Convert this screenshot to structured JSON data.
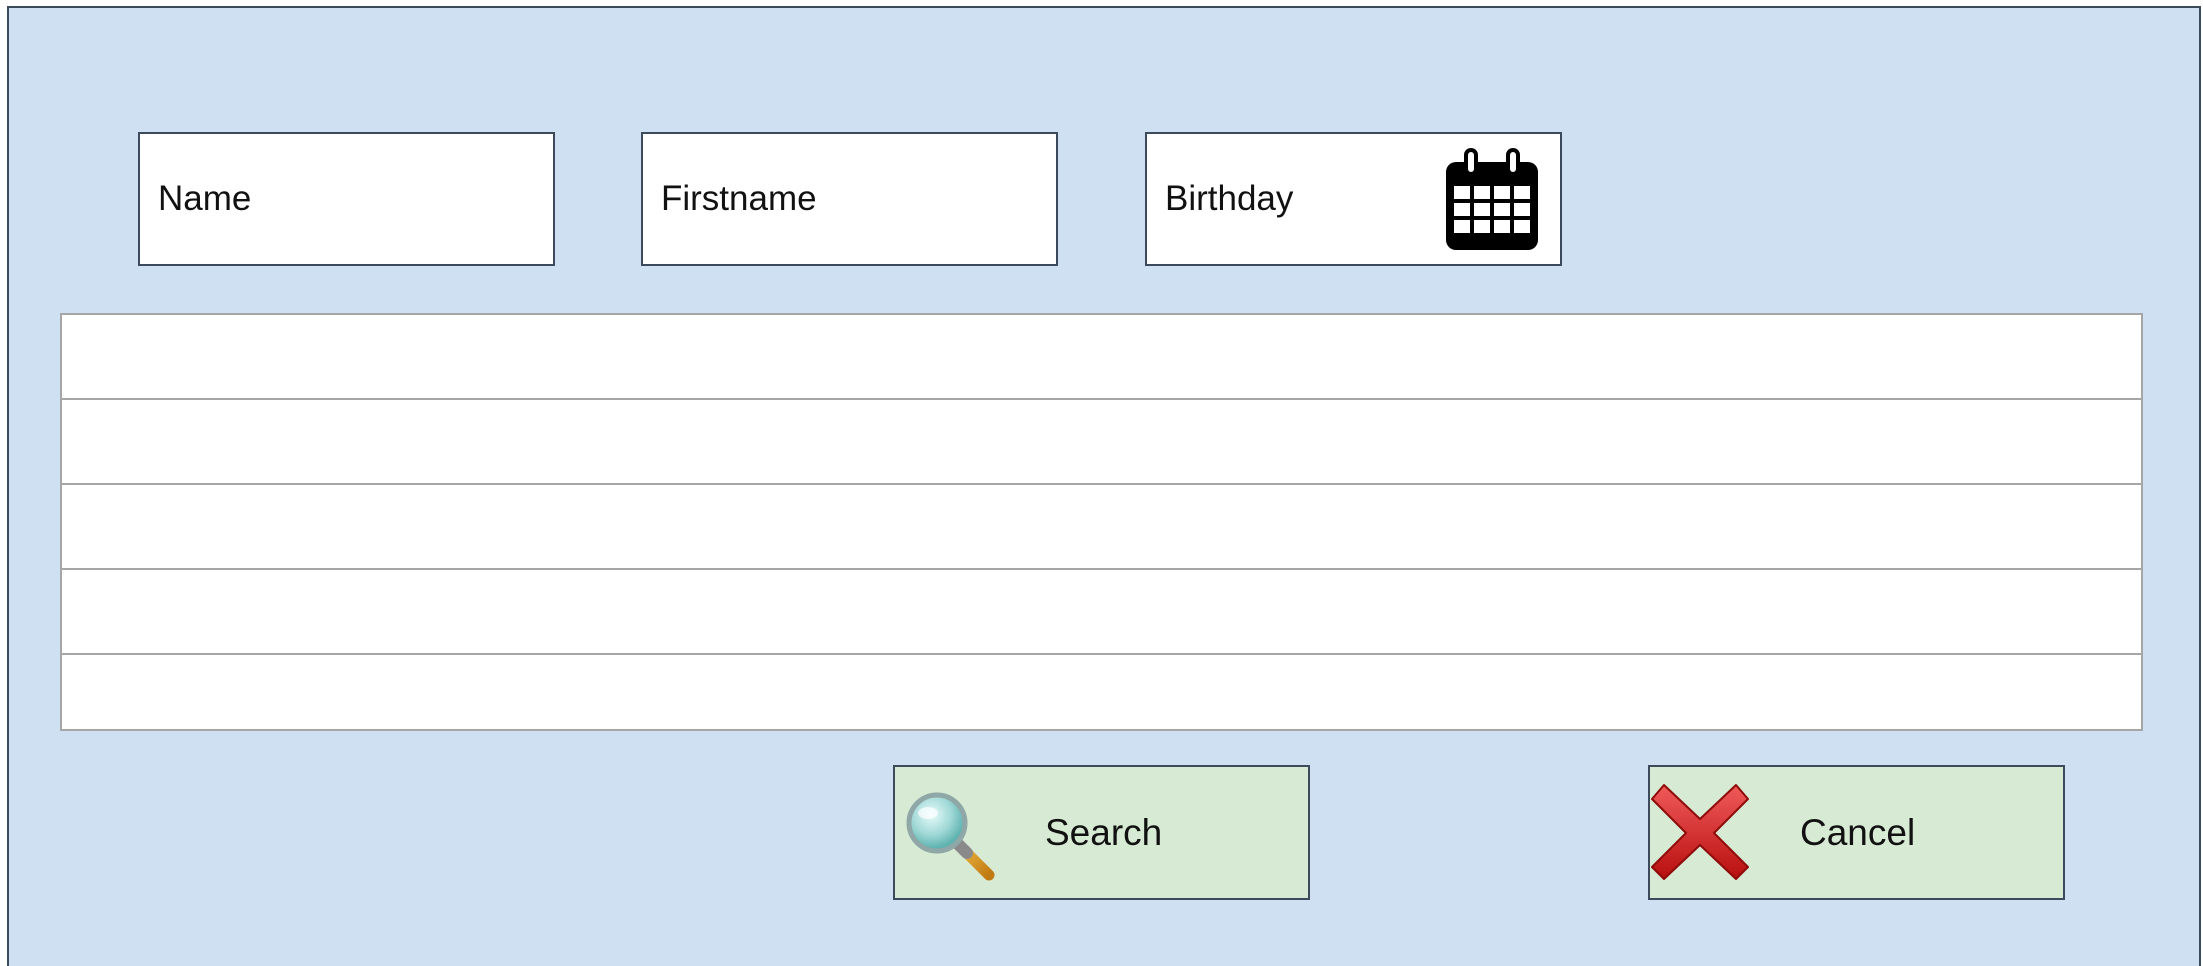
{
  "form": {
    "name_placeholder": "Name",
    "firstname_placeholder": "Firstname",
    "birthday_placeholder": "Birthday"
  },
  "results": {
    "rows": [
      "",
      "",
      "",
      "",
      ""
    ]
  },
  "actions": {
    "search_label": "Search",
    "cancel_label": "Cancel"
  },
  "icons": {
    "calendar": "calendar-icon",
    "search": "magnifier-icon",
    "cancel": "red-x-icon"
  },
  "colors": {
    "panel_bg": "#cfe0f2",
    "button_bg": "#d7ead3",
    "field_bg": "#ffffff",
    "cancel_red": "#d62222"
  }
}
